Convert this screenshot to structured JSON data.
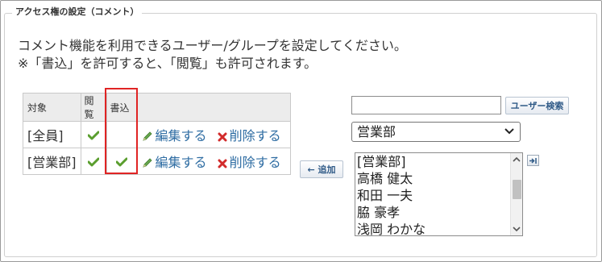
{
  "section": {
    "legend": "アクセス権の設定（コメント）",
    "description_line1": "コメント機能を利用できるユーザー/グループを設定してください。",
    "description_line2": "※「書込」を許可すると、「閲覧」も許可されます。"
  },
  "table": {
    "headers": {
      "target": "対象",
      "view": "閲覧",
      "write": "書込"
    },
    "rows": [
      {
        "target": "[全員]",
        "view": true,
        "write": false,
        "edit_label": "編集する",
        "delete_label": "削除する"
      },
      {
        "target": "[営業部]",
        "view": true,
        "write": true,
        "edit_label": "編集する",
        "delete_label": "削除する"
      }
    ]
  },
  "add_button": {
    "label": "← 追加"
  },
  "user_search": {
    "input_value": "",
    "button_label": "ユーザー検索"
  },
  "group_select": {
    "selected": "営業部"
  },
  "member_list": {
    "items": [
      "[営業部]",
      "高橋 健太",
      "和田 一夫",
      "脇 豪孝",
      "浅岡 わかな"
    ]
  },
  "icons": {
    "check": "check-icon",
    "edit": "pencil-icon",
    "delete": "x-icon",
    "expand": "expand-icon"
  },
  "colors": {
    "link": "#2f6da3",
    "check": "#5a9e2e",
    "delete": "#d22b2b",
    "highlight": "#e02424"
  }
}
